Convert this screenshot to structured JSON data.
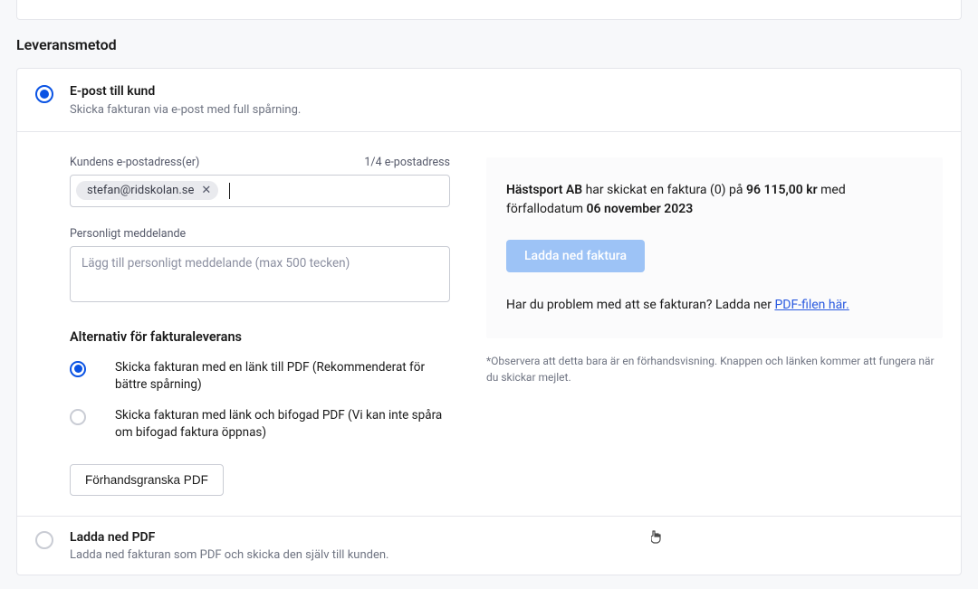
{
  "section_title": "Leveransmetod",
  "option_email": {
    "title": "E-post till kund",
    "subtitle": "Skicka fakturan via e-post med full spårning."
  },
  "email_field": {
    "label": "Kundens e-postadress(er)",
    "count": "1/4 e-postadress",
    "chip": "stefan@ridskolan.se"
  },
  "message_field": {
    "label": "Personligt meddelande",
    "placeholder": "Lägg till personligt meddelande (max 500 tecken)"
  },
  "delivery_options": {
    "title": "Alternativ för fakturaleverans",
    "opt1": "Skicka fakturan med en länk till PDF (Rekommenderat för bättre spårning)",
    "opt2": "Skicka fakturan med länk och bifogad PDF (Vi kan inte spåra om bifogad faktura öppnas)"
  },
  "preview_btn": "Förhandsgranska PDF",
  "preview": {
    "sender": "Hästsport AB",
    "text1": " har skickat en faktura (0) på ",
    "amount": "96 115,00 kr",
    "text2": " med förfallodatum ",
    "due": "06 november 2023",
    "download_btn": "Ladda ned faktura",
    "help_prefix": "Har du problem med att se fakturan? Ladda ner ",
    "help_link": "PDF-filen här."
  },
  "note": "*Observera att detta bara är en förhandsvisning. Knappen och länken kommer att fungera när du skickar mejlet.",
  "option_download": {
    "title": "Ladda ned PDF",
    "subtitle": "Ladda ned fakturan som PDF och skicka den själv till kunden."
  }
}
